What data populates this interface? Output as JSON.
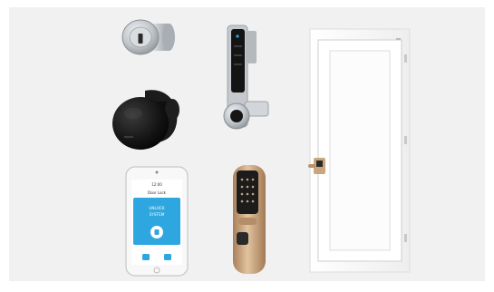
{
  "products": [
    {
      "id": "mortise-cylinder",
      "kind": "lock cylinder"
    },
    {
      "id": "knob-smart-lock",
      "kind": "smart knob lock"
    },
    {
      "id": "cabinet-keypad-lock",
      "kind": "keypad cabinet lock"
    },
    {
      "id": "smartphone-app",
      "kind": "phone app"
    },
    {
      "id": "fingerprint-door-lock",
      "kind": "fingerprint push-pull lock"
    },
    {
      "id": "white-door",
      "kind": "door with installed lock"
    }
  ],
  "phone": {
    "status_text": "12:00",
    "header_text": "Door Lock",
    "card_line1": "UNLOCK",
    "card_line2": "SYSTEM"
  },
  "colors": {
    "background": "#f1f1f1",
    "chrome": "#c9cdd1",
    "black": "#141414",
    "app_blue": "#2ea6df",
    "gold": "#c9a27a",
    "door": "#fbfbfb"
  }
}
